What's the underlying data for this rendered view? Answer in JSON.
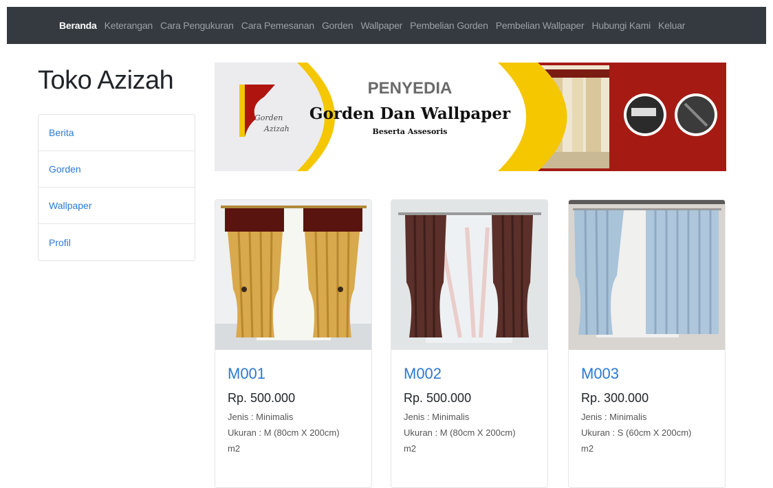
{
  "nav": {
    "items": [
      {
        "label": "Beranda",
        "active": true
      },
      {
        "label": "Keterangan",
        "active": false
      },
      {
        "label": "Cara Pengukuran",
        "active": false
      },
      {
        "label": "Cara Pemesanan",
        "active": false
      },
      {
        "label": "Gorden",
        "active": false
      },
      {
        "label": "Wallpaper",
        "active": false
      },
      {
        "label": "Pembelian Gorden",
        "active": false
      },
      {
        "label": "Pembelian Wallpaper",
        "active": false
      },
      {
        "label": "Hubungi Kami",
        "active": false
      },
      {
        "label": "Keluar",
        "active": false
      }
    ]
  },
  "brand": {
    "title": "Toko Azizah"
  },
  "sidebar": {
    "items": [
      {
        "label": "Berita"
      },
      {
        "label": "Gorden"
      },
      {
        "label": "Wallpaper"
      },
      {
        "label": "Profil"
      }
    ]
  },
  "banner": {
    "logo_line1": "Gorden",
    "logo_line2": "Azizah",
    "heading": "PENYEDIA",
    "subheading": "Gorden Dan Wallpaper",
    "tagline": "Beserta Assesoris"
  },
  "products": [
    {
      "code": "M001",
      "price": "Rp. 500.000",
      "type": "Jenis : Minimalis",
      "size": "Ukuran : M (80cm X 200cm)",
      "unit": "m2",
      "image_icon": "gold-curtain-image"
    },
    {
      "code": "M002",
      "price": "Rp. 500.000",
      "type": "Jenis : Minimalis",
      "size": "Ukuran : M (80cm X 200cm)",
      "unit": "m2",
      "image_icon": "brown-curtain-image"
    },
    {
      "code": "M003",
      "price": "Rp. 300.000",
      "type": "Jenis : Minimalis",
      "size": "Ukuran : S (60cm X 200cm)",
      "unit": "m2",
      "image_icon": "blue-curtain-image"
    }
  ],
  "colors": {
    "navbar_bg": "#343a40",
    "link_blue": "#2a7ad3",
    "banner_red": "#a51b14",
    "banner_yellow": "#f4c700"
  }
}
